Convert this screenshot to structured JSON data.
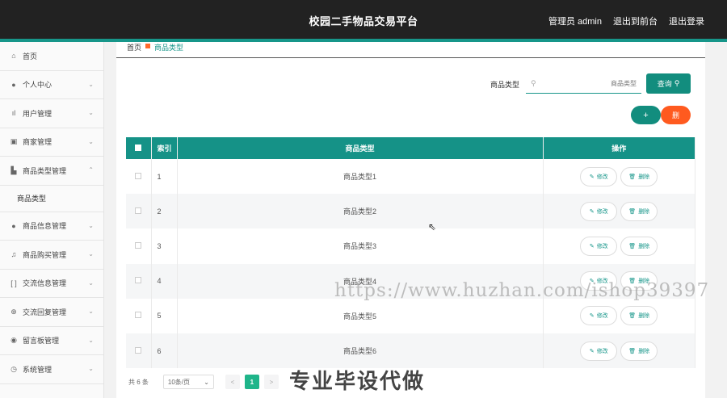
{
  "header": {
    "title": "校园二手物品交易平台",
    "admin_label": "管理员 admin",
    "back_label": "退出到前台",
    "logout_label": "退出登录"
  },
  "sidebar": {
    "items": [
      {
        "label": "首页",
        "icon": "home-icon"
      },
      {
        "label": "个人中心",
        "icon": "user-icon"
      },
      {
        "label": "用户管理",
        "icon": "bar-chart-icon"
      },
      {
        "label": "商家管理",
        "icon": "store-icon"
      },
      {
        "label": "商品类型管理",
        "icon": "category-icon"
      },
      {
        "label": "商品类型",
        "icon": ""
      },
      {
        "label": "商品信息管理",
        "icon": "user-icon"
      },
      {
        "label": "商品购买管理",
        "icon": "bell-icon"
      },
      {
        "label": "交流信息管理",
        "icon": "scan-icon"
      },
      {
        "label": "交流回复管理",
        "icon": "compass-icon"
      },
      {
        "label": "留言板管理",
        "icon": "location-icon"
      },
      {
        "label": "系统管理",
        "icon": "clock-icon"
      }
    ]
  },
  "breadcrumb": {
    "home": "首页",
    "current": "商品类型"
  },
  "search": {
    "label": "商品类型",
    "placeholder": "商品类型",
    "button": "查询"
  },
  "actions": {
    "add": "+",
    "delete": "删"
  },
  "table": {
    "columns": [
      "索引",
      "商品类型",
      "操作"
    ],
    "rows": [
      {
        "index": "1",
        "type": "商品类型1"
      },
      {
        "index": "2",
        "type": "商品类型2"
      },
      {
        "index": "3",
        "type": "商品类型3"
      },
      {
        "index": "4",
        "type": "商品类型4"
      },
      {
        "index": "5",
        "type": "商品类型5"
      },
      {
        "index": "6",
        "type": "商品类型6"
      }
    ],
    "edit_label": "修改",
    "delete_label": "删除"
  },
  "pagination": {
    "total": "共 6 条",
    "page_size": "10条/页",
    "current_page": "1",
    "prev": "<",
    "next": ">"
  },
  "watermarks": {
    "url": "https://www.huzhan.com/ishop39397",
    "cn": "专业毕设代做"
  },
  "colors": {
    "primary": "#159287",
    "danger": "#ff5a1f",
    "topbar": "#222222"
  }
}
